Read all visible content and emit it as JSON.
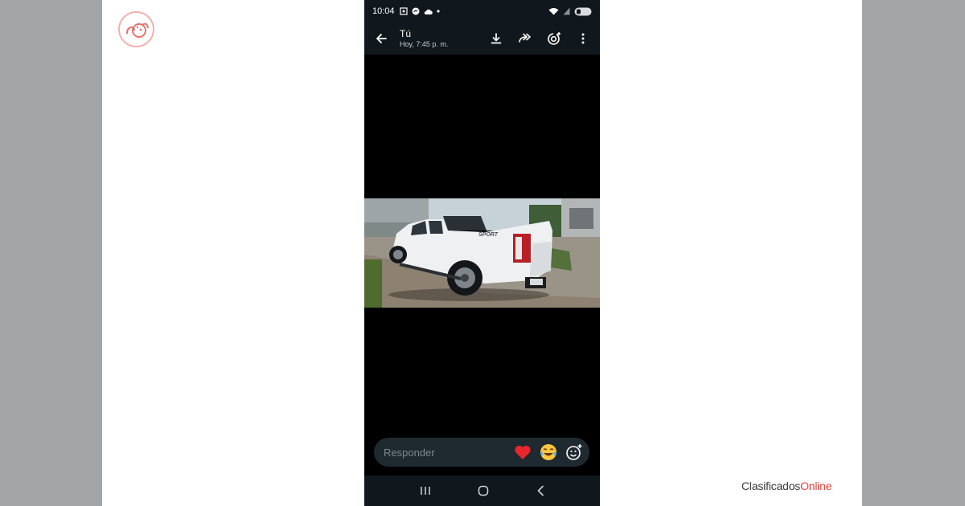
{
  "status_bar": {
    "time": "10:04"
  },
  "header": {
    "title": "Tú",
    "subtitle": "Hoy, 7:45 p. m."
  },
  "photo": {
    "decal_text": "SPORT"
  },
  "reply": {
    "placeholder": "Responder",
    "reactions": [
      "red-heart",
      "tears-of-joy"
    ]
  },
  "brand": {
    "prefix": "Clasificados",
    "suffix": "Online"
  },
  "colors": {
    "bar_bg": "#10181d",
    "reply_bg": "#1f2a30",
    "brand_accent": "#e8403a",
    "side_bg": "#a3a5a7"
  }
}
